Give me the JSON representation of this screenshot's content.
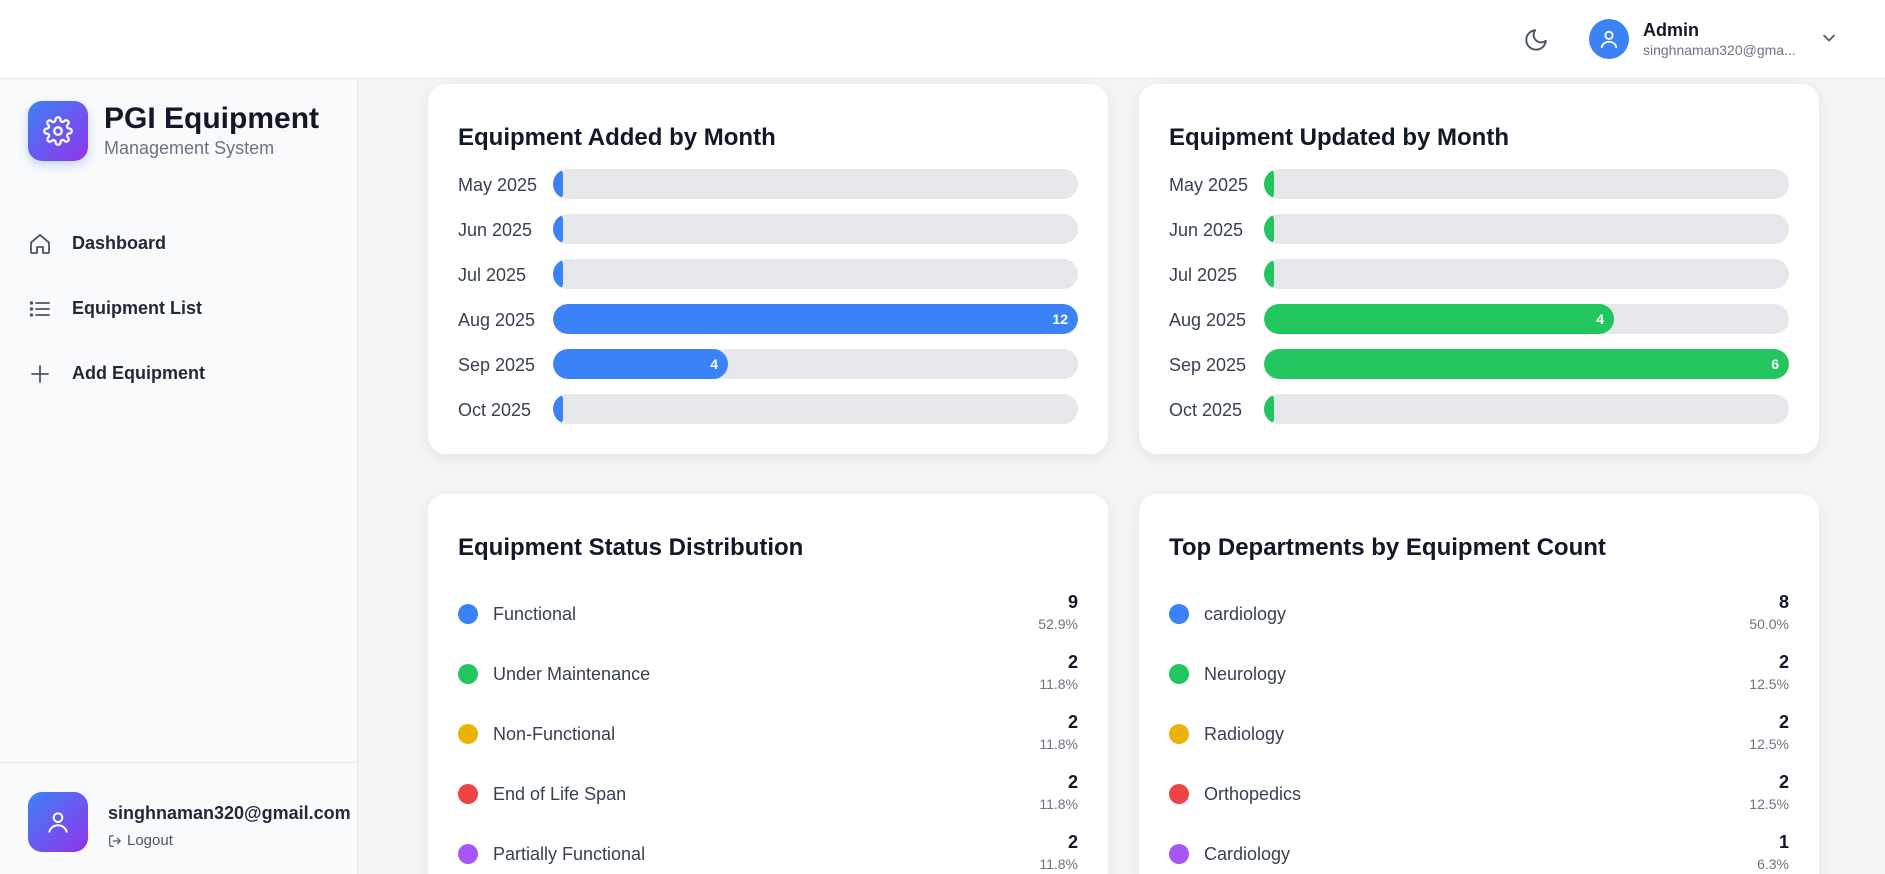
{
  "header": {
    "user_name": "Admin",
    "user_email": "singhnaman320@gma..."
  },
  "sidebar": {
    "brand_title": "PGI Equipment",
    "brand_subtitle": "Management System",
    "items": [
      {
        "label": "Dashboard",
        "icon": "home-icon"
      },
      {
        "label": "Equipment List",
        "icon": "list-icon"
      },
      {
        "label": "Add Equipment",
        "icon": "plus-icon"
      }
    ],
    "footer_email": "singhnaman320@gmail.com",
    "logout_label": "Logout"
  },
  "cards": {
    "added": {
      "title": "Equipment Added by Month",
      "color": "#3b82f6",
      "rows": [
        {
          "label": "May 2025",
          "value": 0,
          "value_label": ""
        },
        {
          "label": "Jun 2025",
          "value": 0,
          "value_label": ""
        },
        {
          "label": "Jul 2025",
          "value": 0,
          "value_label": ""
        },
        {
          "label": "Aug 2025",
          "value": 12,
          "value_label": "12"
        },
        {
          "label": "Sep 2025",
          "value": 4,
          "value_label": "4"
        },
        {
          "label": "Oct 2025",
          "value": 0,
          "value_label": ""
        }
      ]
    },
    "updated": {
      "title": "Equipment Updated by Month",
      "color": "#22c55e",
      "rows": [
        {
          "label": "May 2025",
          "value": 0,
          "value_label": ""
        },
        {
          "label": "Jun 2025",
          "value": 0,
          "value_label": ""
        },
        {
          "label": "Jul 2025",
          "value": 0,
          "value_label": ""
        },
        {
          "label": "Aug 2025",
          "value": 4,
          "value_label": "4"
        },
        {
          "label": "Sep 2025",
          "value": 6,
          "value_label": "6"
        },
        {
          "label": "Oct 2025",
          "value": 0,
          "value_label": ""
        }
      ]
    },
    "status": {
      "title": "Equipment Status Distribution",
      "rows": [
        {
          "label": "Functional",
          "count": "9",
          "pct": "52.9%",
          "color": "#3b82f6"
        },
        {
          "label": "Under Maintenance",
          "count": "2",
          "pct": "11.8%",
          "color": "#22c55e"
        },
        {
          "label": "Non-Functional",
          "count": "2",
          "pct": "11.8%",
          "color": "#eab308"
        },
        {
          "label": "End of Life Span",
          "count": "2",
          "pct": "11.8%",
          "color": "#ef4444"
        },
        {
          "label": "Partially Functional",
          "count": "2",
          "pct": "11.8%",
          "color": "#a855f7"
        }
      ]
    },
    "departments": {
      "title": "Top Departments by Equipment Count",
      "rows": [
        {
          "label": "cardiology",
          "count": "8",
          "pct": "50.0%",
          "color": "#3b82f6"
        },
        {
          "label": "Neurology",
          "count": "2",
          "pct": "12.5%",
          "color": "#22c55e"
        },
        {
          "label": "Radiology",
          "count": "2",
          "pct": "12.5%",
          "color": "#eab308"
        },
        {
          "label": "Orthopedics",
          "count": "2",
          "pct": "12.5%",
          "color": "#ef4444"
        },
        {
          "label": "Cardiology",
          "count": "1",
          "pct": "6.3%",
          "color": "#a855f7"
        }
      ]
    }
  }
}
